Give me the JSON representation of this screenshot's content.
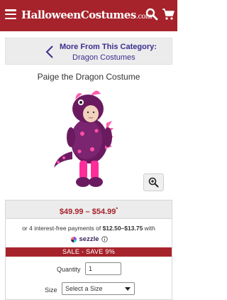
{
  "header": {
    "logo_text": "HalloweenCostumes",
    "logo_suffix": ".com",
    "background_color": "#a6232b",
    "icons": [
      "hamburger-menu-icon",
      "search-icon",
      "shopping-cart-icon"
    ]
  },
  "category_nav": {
    "heading": "More From This Category:",
    "link": "Dragon Costumes",
    "icon": "chevron-left-icon",
    "color": "#3b2f8f"
  },
  "product": {
    "title": "Paige the Dragon Costume",
    "image_alt": "child in purple dragon costume",
    "zoom_icon": "zoom-in-icon"
  },
  "pricing": {
    "price_range": "$49.99 – $54.99",
    "price_marker": "*",
    "installments_prefix": "or 4 interest-free payments of ",
    "installments_amount": "$12.50–$13.75",
    "installments_suffix": " with",
    "provider": "sezzle",
    "info_icon": "info-icon",
    "sale_banner": "SALE - SAVE 9%",
    "sale_color": "#a6232b"
  },
  "form": {
    "quantity_label": "Quantity",
    "quantity_value": "1",
    "size_label": "Size",
    "size_selected": "Select a Size"
  }
}
